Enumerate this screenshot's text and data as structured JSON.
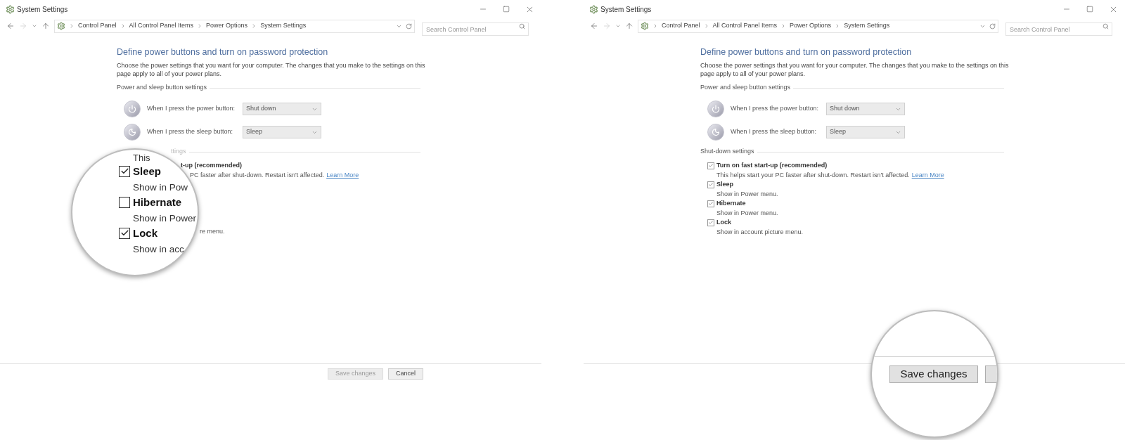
{
  "windows": [
    {
      "title": "System Settings",
      "breadcrumb": [
        "Control Panel",
        "All Control Panel Items",
        "Power Options",
        "System Settings"
      ],
      "search": {
        "placeholder": "Search Control Panel"
      },
      "heading": "Define power buttons and turn on password protection",
      "intro": "Choose the power settings that you want for your computer. The changes that you make to the settings on this page apply to all of your power plans.",
      "power_section": {
        "title": "Power and sleep button settings",
        "rows": [
          {
            "kind": "power",
            "label": "When I press the power button:",
            "value": "Shut down"
          },
          {
            "kind": "sleep",
            "label": "When I press the sleep button:",
            "value": "Sleep"
          }
        ]
      },
      "shutdown_section": {
        "kind": "covered",
        "title": "ttings",
        "items": [
          {
            "label": "t-up (recommended)",
            "description": "PC faster after shut-down. Restart isn't affected.",
            "link": "Learn More"
          },
          {
            "description": "re menu."
          }
        ]
      },
      "buttons": [
        {
          "label": "Save changes",
          "disabled": true
        },
        {
          "label": "Cancel",
          "disabled": false
        }
      ],
      "magnifier": {
        "kind": "checkboxes",
        "title": "This",
        "items": [
          {
            "label": "Sleep",
            "description": "Show in Pow",
            "checked": true
          },
          {
            "label": "Hibernate",
            "description": "Show in Power",
            "checked": false
          },
          {
            "label": "Lock",
            "description": "Show in acc",
            "checked": true
          }
        ]
      }
    },
    {
      "title": "System Settings",
      "breadcrumb": [
        "Control Panel",
        "All Control Panel Items",
        "Power Options",
        "System Settings"
      ],
      "search": {
        "placeholder": "Search Control Panel"
      },
      "heading": "Define power buttons and turn on password protection",
      "intro": "Choose the power settings that you want for your computer. The changes that you make to the settings on this page apply to all of your power plans.",
      "power_section": {
        "title": "Power and sleep button settings",
        "rows": [
          {
            "kind": "power",
            "label": "When I press the power button:",
            "value": "Shut down"
          },
          {
            "kind": "sleep",
            "label": "When I press the sleep button:",
            "value": "Sleep"
          }
        ]
      },
      "shutdown_section": {
        "kind": "full",
        "title": "Shut-down settings",
        "items": [
          {
            "label": "Turn on fast start-up (recommended)",
            "description": "This helps start your PC faster after shut-down. Restart isn't affected.",
            "link": "Learn More",
            "checked": true
          },
          {
            "label": "Sleep",
            "description": "Show in Power menu.",
            "checked": true
          },
          {
            "label": "Hibernate",
            "description": "Show in Power menu.",
            "checked": true
          },
          {
            "label": "Lock",
            "description": "Show in account picture menu.",
            "checked": true
          }
        ]
      },
      "magnifier": {
        "kind": "buttons",
        "buttons": [
          {
            "kind": "labeled",
            "label": "Save changes",
            "disabled": false
          },
          {
            "kind": "blank"
          }
        ]
      }
    }
  ]
}
